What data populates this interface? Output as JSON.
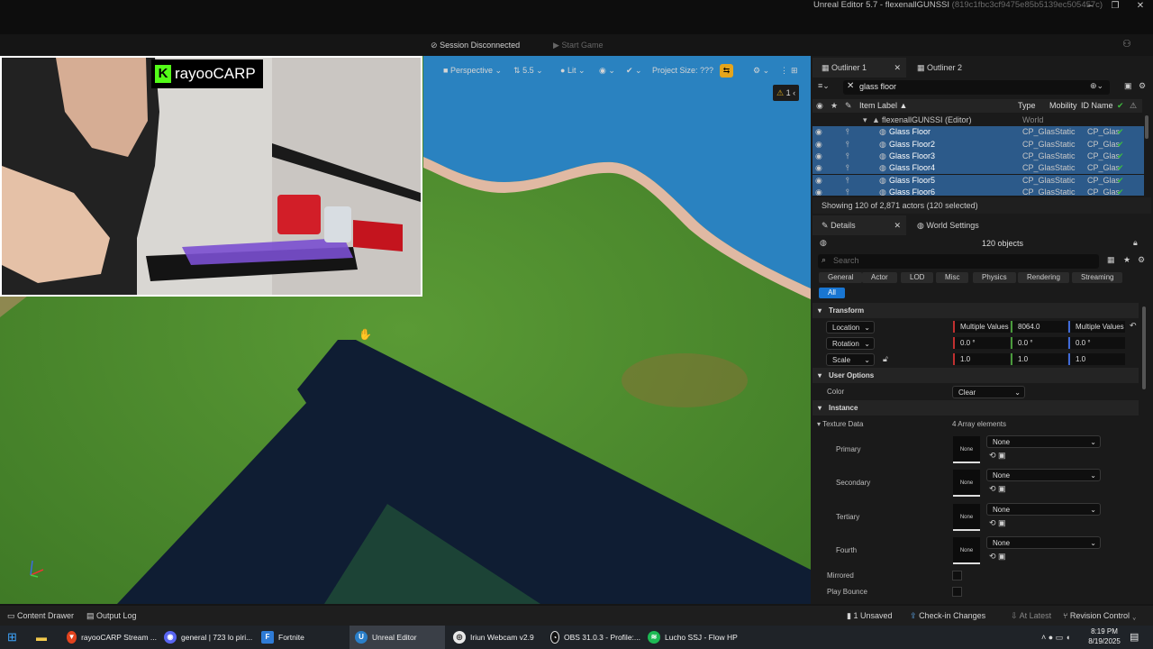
{
  "window": {
    "title": "Unreal Editor 5.7 - flexenallGUNSSI",
    "hash": "(819c1fbc3cf9475e85b5139ec505457c)"
  },
  "session": {
    "status": "Session Disconnected",
    "start_game": "Start Game"
  },
  "viewport": {
    "perspective": "Perspective",
    "speed": "5.5",
    "lit": "Lit",
    "project_size": "Project Size: ???",
    "warning_count": "1"
  },
  "webcam": {
    "logo_letter": "K",
    "logo_text": "rayooCARP"
  },
  "outliner": {
    "tabs": [
      "Outliner 1",
      "Outliner 2"
    ],
    "search": "glass floor",
    "columns": {
      "label": "Item Label ▲",
      "type": "Type",
      "mobility": "Mobility",
      "id": "ID Name"
    },
    "root": {
      "label": "flexenallGUNSSI (Editor)",
      "type": "World"
    },
    "rows": [
      {
        "label": "Glass Floor",
        "type": "CP_Glas",
        "mobility": "Static",
        "id": "CP_Glas"
      },
      {
        "label": "Glass Floor2",
        "type": "CP_Glas",
        "mobility": "Static",
        "id": "CP_Glas"
      },
      {
        "label": "Glass Floor3",
        "type": "CP_Glas",
        "mobility": "Static",
        "id": "CP_Glas"
      },
      {
        "label": "Glass Floor4",
        "type": "CP_Glas",
        "mobility": "Static",
        "id": "CP_Glas"
      },
      {
        "label": "Glass Floor5",
        "type": "CP_Glas",
        "mobility": "Static",
        "id": "CP_Glas"
      },
      {
        "label": "Glass Floor6",
        "type": "CP_Glas",
        "mobility": "Static",
        "id": "CP_Glas"
      }
    ],
    "status": "Showing 120 of 2,871 actors (120 selected)"
  },
  "details": {
    "tabs": [
      "Details",
      "World Settings"
    ],
    "objects": "120 objects",
    "search_placeholder": "Search",
    "categories": [
      "General",
      "Actor",
      "LOD",
      "Misc",
      "Physics",
      "Rendering",
      "Streaming"
    ],
    "all": "All",
    "transform": {
      "header": "Transform",
      "location": {
        "label": "Location",
        "x": "Multiple Values",
        "y": "8064.0",
        "z": "Multiple Values"
      },
      "rotation": {
        "label": "Rotation",
        "x": "0.0 °",
        "y": "0.0 °",
        "z": "0.0 °"
      },
      "scale": {
        "label": "Scale",
        "x": "1.0",
        "y": "1.0",
        "z": "1.0"
      }
    },
    "user_options": {
      "header": "User Options",
      "color_label": "Color",
      "color_value": "Clear"
    },
    "instance": {
      "header": "Instance",
      "texture_data": "Texture Data",
      "array": "4 Array elements",
      "slots": [
        {
          "label": "Primary",
          "thumb": "None",
          "value": "None"
        },
        {
          "label": "Secondary",
          "thumb": "None",
          "value": "None"
        },
        {
          "label": "Tertiary",
          "thumb": "None",
          "value": "None"
        },
        {
          "label": "Fourth",
          "thumb": "None",
          "value": "None"
        }
      ],
      "mirrored": "Mirrored",
      "play_bounce": "Play Bounce"
    }
  },
  "statusbar": {
    "content_drawer": "Content Drawer",
    "output_log": "Output Log",
    "unsaved": "1 Unsaved",
    "checkin": "Check-in Changes",
    "at_latest": "At Latest",
    "revision": "Revision Control"
  },
  "taskbar": {
    "items": [
      "rayooCARP Stream ...",
      "general | 723 lo piri...",
      "Fortnite",
      "Unreal Editor",
      "Iriun Webcam v2.9",
      "OBS 31.0.3 - Profile:...",
      "Lucho SSJ - Flow HP"
    ],
    "time": "8:19 PM",
    "date": "8/19/2025"
  }
}
